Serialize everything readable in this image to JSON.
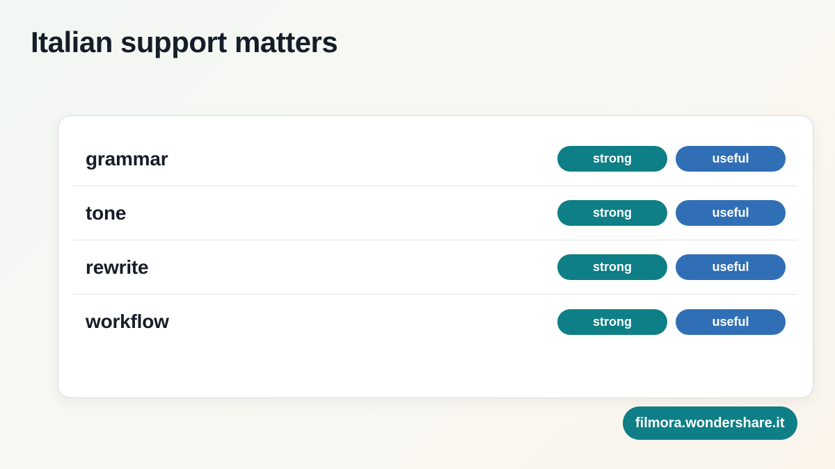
{
  "title": "Italian support matters",
  "colors": {
    "strong_pill": "#0e7f86",
    "useful_pill": "#306fb6",
    "badge": "#0e7f86",
    "text": "#151d28"
  },
  "rows": [
    {
      "label": "grammar",
      "tags": [
        "strong",
        "useful"
      ]
    },
    {
      "label": "tone",
      "tags": [
        "strong",
        "useful"
      ]
    },
    {
      "label": "rewrite",
      "tags": [
        "strong",
        "useful"
      ]
    },
    {
      "label": "workflow",
      "tags": [
        "strong",
        "useful"
      ]
    }
  ],
  "footer": {
    "badge_text": "filmora.wondershare.it"
  }
}
